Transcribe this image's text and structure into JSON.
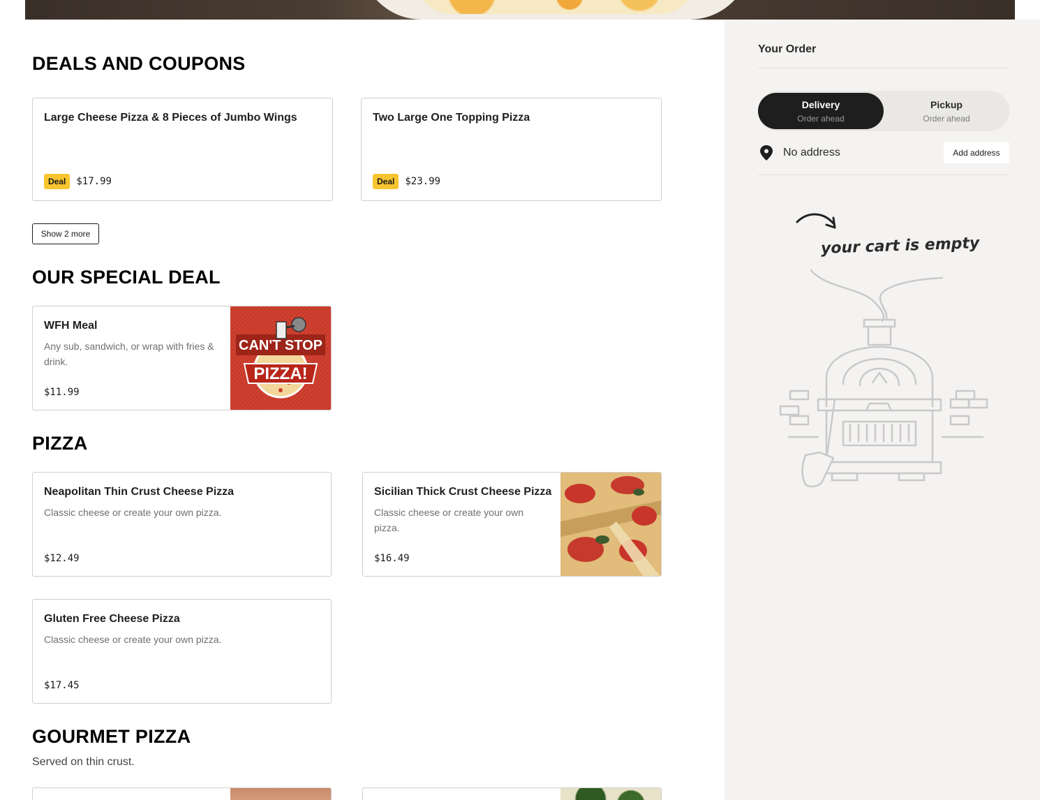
{
  "sections": {
    "deals": {
      "title": "DEALS AND COUPONS",
      "items": [
        {
          "title": "Large Cheese Pizza & 8 Pieces of Jumbo Wings",
          "badge": "Deal",
          "price": "$17.99"
        },
        {
          "title": "Two Large One Topping Pizza",
          "badge": "Deal",
          "price": "$23.99"
        }
      ],
      "show_more": "Show 2 more"
    },
    "special": {
      "title": "OUR SPECIAL DEAL",
      "items": [
        {
          "title": "WFH Meal",
          "desc": "Any sub, sandwich, or wrap with fries & drink.",
          "price": "$11.99",
          "img_text_top": "CAN'T STOP",
          "img_text_main": "PIZZA!"
        }
      ]
    },
    "pizza": {
      "title": "PIZZA",
      "items": [
        {
          "title": "Neapolitan Thin Crust Cheese Pizza",
          "desc": "Classic cheese or create your own pizza.",
          "price": "$12.49"
        },
        {
          "title": "Sicilian Thick Crust Cheese Pizza",
          "desc": "Classic cheese or create your own pizza.",
          "price": "$16.49"
        },
        {
          "title": "Gluten Free Cheese Pizza",
          "desc": "Classic cheese or create your own pizza.",
          "price": "$17.45"
        }
      ]
    },
    "gourmet": {
      "title": "GOURMET PIZZA",
      "subtitle": "Served on thin crust."
    }
  },
  "sidebar": {
    "title": "Your Order",
    "delivery": {
      "label": "Delivery",
      "sub": "Order ahead"
    },
    "pickup": {
      "label": "Pickup",
      "sub": "Order ahead"
    },
    "address": "No address",
    "add_address": "Add address",
    "empty_cart": "your cart is empty"
  },
  "colors": {
    "accent_badge": "#f8c530",
    "toggle_active": "#1e1e1e",
    "sidebar_bg": "#f4f3f1"
  }
}
